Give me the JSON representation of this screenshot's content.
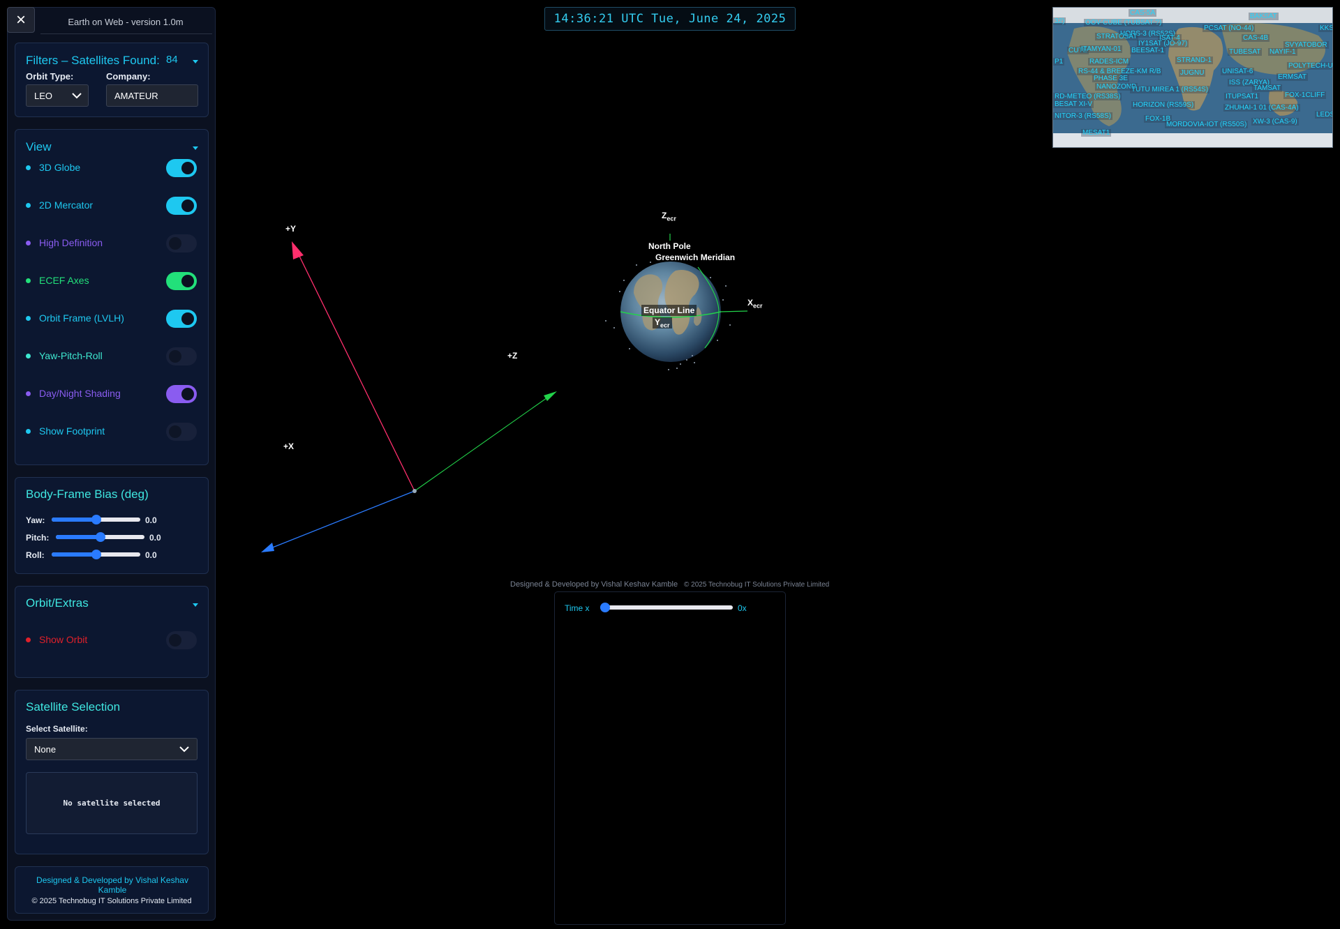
{
  "app": {
    "title": "Earth on Web - version 1.0m",
    "close_icon": "×"
  },
  "clock": {
    "text": "14:36:21 UTC Tue, June 24, 2025"
  },
  "filters": {
    "title": "Filters – Satellites Found:",
    "count": "84",
    "orbit_type_label": "Orbit Type:",
    "orbit_type_value": "LEO",
    "company_label": "Company:",
    "company_value": "AMATEUR"
  },
  "view": {
    "title": "View",
    "items": [
      {
        "label": "3D Globe",
        "on": true,
        "color": "#1ec8f0"
      },
      {
        "label": "2D Mercator",
        "on": true,
        "color": "#1ec8f0"
      },
      {
        "label": "High Definition",
        "on": false,
        "color": "#8a5cf0"
      },
      {
        "label": "ECEF Axes",
        "on": true,
        "color": "#22e07a"
      },
      {
        "label": "Orbit Frame (LVLH)",
        "on": true,
        "color": "#1ec8f0"
      },
      {
        "label": "Yaw-Pitch-Roll",
        "on": false,
        "color": "#3ee8d0"
      },
      {
        "label": "Day/Night Shading",
        "on": true,
        "color": "#8a5cf0"
      },
      {
        "label": "Show Footprint",
        "on": false,
        "color": "#1ec8f0"
      }
    ]
  },
  "bias": {
    "title": "Body-Frame Bias (deg)",
    "yaw_label": "Yaw:",
    "yaw_value": "0.0",
    "pitch_label": "Pitch:",
    "pitch_value": "0.0",
    "roll_label": "Roll:",
    "roll_value": "0.0"
  },
  "orbit": {
    "title": "Orbit/Extras",
    "show_orbit_label": "Show Orbit",
    "show_orbit_on": false
  },
  "selection": {
    "title": "Satellite Selection",
    "select_label": "Select Satellite:",
    "select_value": "None",
    "empty_text": "No satellite selected"
  },
  "footer": {
    "line1": "Designed & Developed by Vishal Keshav Kamble",
    "line2": "© 2025 Technobug IT Solutions Private Limited"
  },
  "scene": {
    "axis_y": "+Y",
    "axis_x": "+X",
    "axis_z": "+Z",
    "z_ecr": "Z",
    "x_ecr": "X",
    "y_ecr": "Y",
    "ecr_sub": "ecr",
    "north_pole": "North Pole",
    "greenwich": "Greenwich Meridian",
    "equator": "Equator Line",
    "colors": {
      "y_axis": "#ff2f6d",
      "z_axis": "#22d34a",
      "x_axis": "#2a7bff"
    }
  },
  "credit": {
    "main": "Designed & Developed by Vishal Keshav Kamble",
    "copy": "© 2025 Technobug IT Solutions Private Limited"
  },
  "time": {
    "label": "Time x",
    "value": "0x",
    "multiplier": 0
  },
  "minimap": {
    "labels": [
      "CAS-5A",
      "BAKSAT",
      "KKS",
      "32)",
      "OOV-CUBE (TUBSAT-?)",
      "PCSAT (NO-44)",
      "HORS-3 (RS52S)",
      "STRATOSAT",
      "ISAT-4",
      "CAS-4B",
      "SVYATOBOR",
      "CUTE",
      "ITAMYAN-01",
      "BEESAT-1",
      "IY1SAT (JO-97)",
      "TUBESAT",
      "NAYIF-1",
      "P1",
      "RADES-ICM",
      "STRAND-1",
      "POLYTECH-UNIV",
      "RS-44 & BREEZE-KM R/B",
      "JUGNU",
      "UNISAT-6",
      "PHASE 3E",
      "ERMSAT",
      "ISS (ZARYA)",
      "NANOZOND",
      "TUTU MIREA 1 (RS54S)",
      "RD-METEO (RS38S)",
      "ITUPSAT1",
      "FOX-1CLIFF",
      "TAMSAT",
      "BESAT XI-V",
      "HORIZON (RS59S)",
      "ZHUHAI-1 01 (CAS-4A)",
      "NITOR-3 (RS58S)",
      "FOX-1B",
      "MORDOVIA-IOT (RS50S)",
      "XW-3 (CAS-9)",
      "LEDS",
      "MESAT1"
    ]
  }
}
